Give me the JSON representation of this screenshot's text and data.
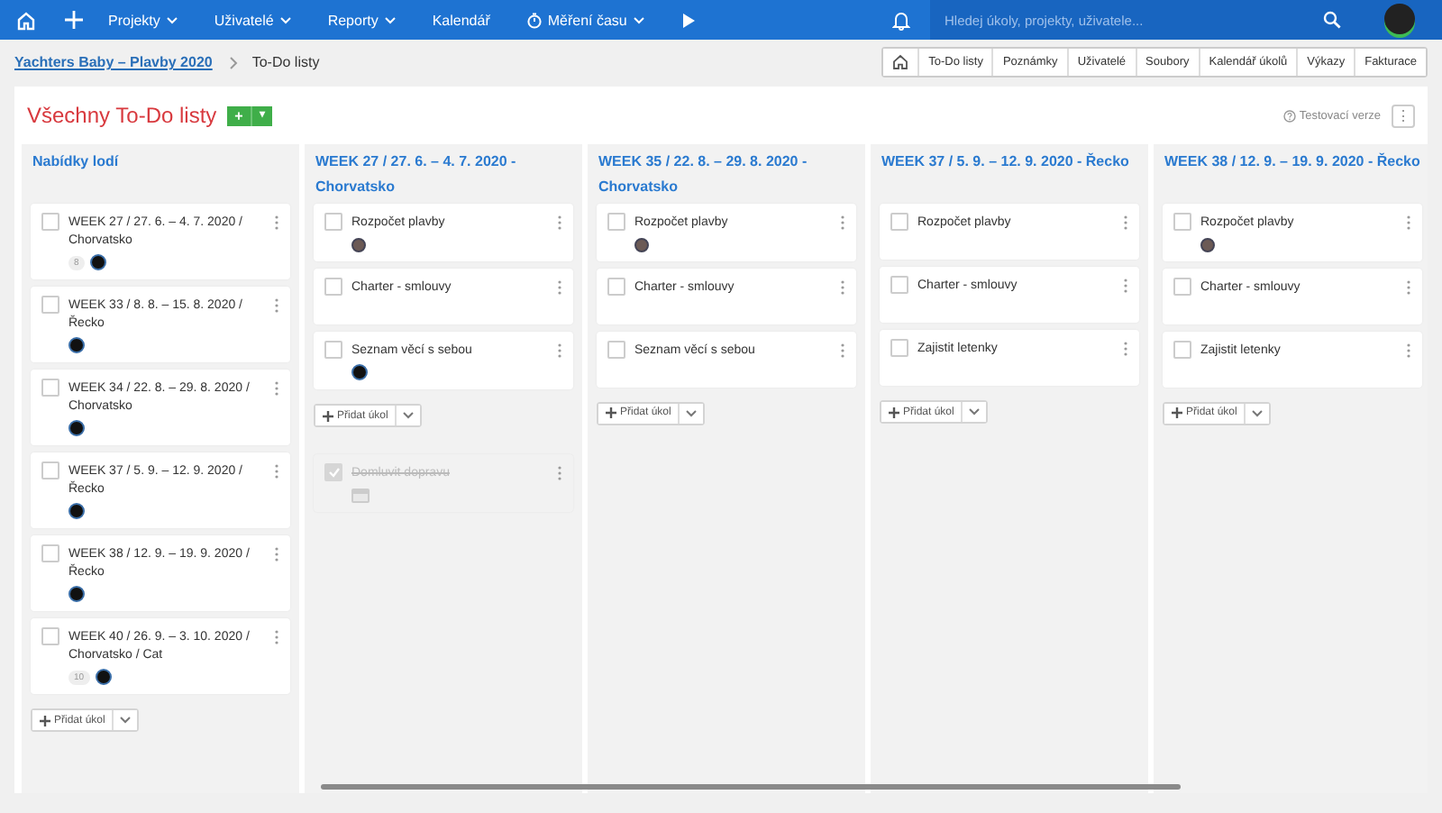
{
  "top_bar": {
    "nav": [
      {
        "label": "Projekty",
        "dropdown": true
      },
      {
        "label": "Uživatelé",
        "dropdown": true
      },
      {
        "label": "Reporty",
        "dropdown": true
      },
      {
        "label": "Kalendář",
        "dropdown": false
      },
      {
        "label": "Měření času",
        "dropdown": true,
        "kind": "timer"
      }
    ],
    "search": {
      "placeholder": "Hledej úkoly, projekty, uživatele..."
    }
  },
  "breadcrumb": {
    "project": "Yachters Baby – Plavby 2020",
    "current": "To-Do listy"
  },
  "section_tabs": [
    "To-Do listy",
    "Poznámky",
    "Uživatelé",
    "Soubory",
    "Kalendář úkolů",
    "Výkazy",
    "Fakturace"
  ],
  "page": {
    "title": "Všechny To-Do listy",
    "add_button": "+",
    "add_menu": "▾",
    "version_note": "Testovací verze",
    "more_button": "⋮"
  },
  "columns": [
    {
      "title": "Nabídky lodí",
      "add_task_label": "Přidat úkol",
      "tasks": [
        {
          "title": "WEEK 27 / 27. 6. – 4. 7. 2020 / Chorvatsko",
          "done": false,
          "count": "8",
          "avatar": {
            "kind": "dark"
          }
        },
        {
          "title": "WEEK 33 / 8. 8. – 15. 8. 2020 / Řecko",
          "done": false,
          "avatar": {
            "kind": "dark"
          }
        },
        {
          "title": "WEEK 34 / 22. 8. – 29. 8. 2020 / Chorvatsko",
          "done": false,
          "avatar": {
            "kind": "dark"
          }
        },
        {
          "title": "WEEK 37 / 5. 9. – 12. 9. 2020 / Řecko",
          "done": false,
          "avatar": {
            "kind": "dark"
          }
        },
        {
          "title": "WEEK 38 / 12. 9. – 19. 9. 2020 / Řecko",
          "done": false,
          "avatar": {
            "kind": "dark"
          }
        },
        {
          "title": "WEEK 40 / 26. 9. – 3. 10. 2020 / Chorvatsko / Cat",
          "done": false,
          "count": "10",
          "avatar": {
            "kind": "dark"
          }
        }
      ]
    },
    {
      "title": "WEEK 27 / 27. 6. – 4. 7. 2020 - Chorvatsko",
      "add_task_label": "Přidat úkol",
      "tasks": [
        {
          "title": "Rozpočet plavby",
          "done": false,
          "avatar": {
            "kind": "photo"
          }
        },
        {
          "title": "Charter - smlouvy",
          "done": false
        },
        {
          "title": "Seznam věcí s sebou",
          "done": false,
          "avatar": {
            "kind": "dark"
          }
        }
      ],
      "completed": [
        {
          "title": "Domluvit dopravu",
          "done": true
        }
      ]
    },
    {
      "title": "WEEK 35 / 22. 8. – 29. 8. 2020 - Chorvatsko",
      "add_task_label": "Přidat úkol",
      "tasks": [
        {
          "title": "Rozpočet plavby",
          "done": false,
          "avatar": {
            "kind": "photo"
          }
        },
        {
          "title": "Charter - smlouvy",
          "done": false
        },
        {
          "title": "Seznam věcí s sebou",
          "done": false
        }
      ]
    },
    {
      "title": "WEEK 37 / 5. 9. – 12. 9. 2020 - Řecko",
      "add_task_label": "Přidat úkol",
      "tasks": [
        {
          "title": "Rozpočet plavby",
          "done": false
        },
        {
          "title": "Charter - smlouvy",
          "done": false
        },
        {
          "title": "Zajistit letenky",
          "done": false
        }
      ]
    },
    {
      "title": "WEEK 38 / 12. 9. – 19. 9. 2020 - Řecko",
      "add_task_label": "Přidat úkol",
      "tasks": [
        {
          "title": "Rozpočet plavby",
          "done": false,
          "avatar": {
            "kind": "photo"
          }
        },
        {
          "title": "Charter - smlouvy",
          "done": false
        },
        {
          "title": "Zajistit letenky",
          "done": false
        }
      ]
    }
  ]
}
